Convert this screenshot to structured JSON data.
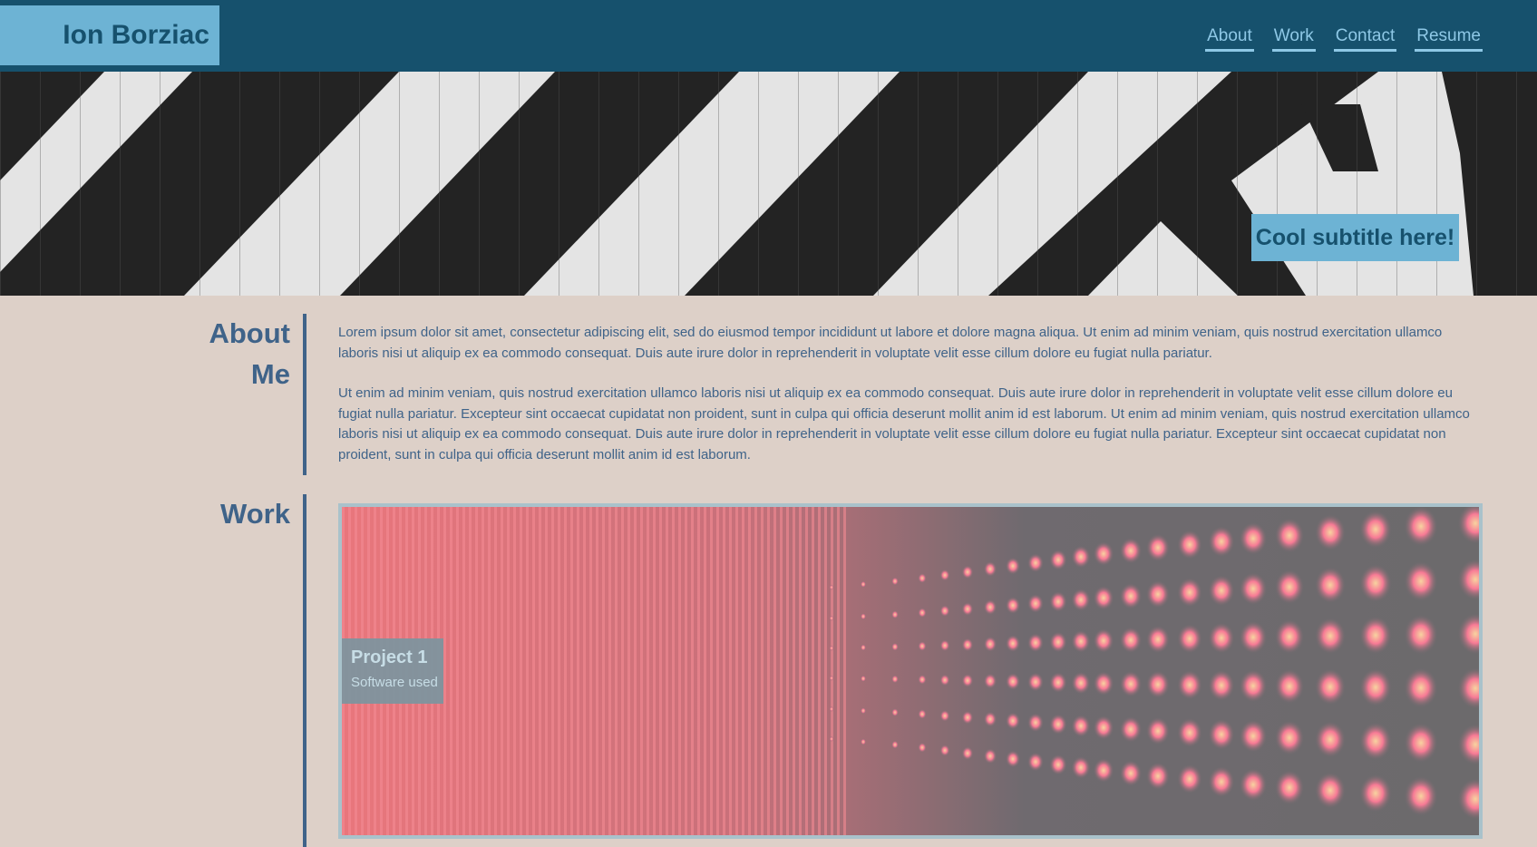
{
  "header": {
    "brand": "Ion Borziac",
    "nav": [
      {
        "label": "About"
      },
      {
        "label": "Work"
      },
      {
        "label": "Contact"
      },
      {
        "label": "Resume"
      }
    ]
  },
  "hero": {
    "subtitle": "Cool subtitle here!"
  },
  "about": {
    "title_line1": "About",
    "title_line2": "Me",
    "paragraphs": [
      "Lorem ipsum dolor sit amet, consectetur adipiscing elit, sed do eiusmod tempor incididunt ut labore et dolore magna aliqua. Ut enim ad minim veniam, quis nostrud exercitation ullamco laboris nisi ut aliquip ex ea commodo consequat. Duis aute irure dolor in reprehenderit in voluptate velit esse cillum dolore eu fugiat nulla pariatur.",
      "Ut enim ad minim veniam, quis nostrud exercitation ullamco laboris nisi ut aliquip ex ea commodo consequat. Duis aute irure dolor in reprehenderit in voluptate velit esse cillum dolore eu fugiat nulla pariatur. Excepteur sint occaecat cupidatat non proident, sunt in culpa qui officia deserunt mollit anim id est laborum. Ut enim ad minim veniam, quis nostrud exercitation ullamco laboris nisi ut aliquip ex ea commodo consequat. Duis aute irure dolor in reprehenderit in voluptate velit esse cillum dolore eu fugiat nulla pariatur. Excepteur sint occaecat cupidatat non proident, sunt in culpa qui officia deserunt mollit anim id est laborum."
    ]
  },
  "work": {
    "title": "Work",
    "projects": [
      {
        "title": "Project 1",
        "subtitle": "Software used"
      }
    ]
  },
  "colors": {
    "header_bg": "#16516d",
    "brand_bg": "#6db3d4",
    "nav_link": "#8ec8e6",
    "page_bg": "#ddd0c8",
    "accent_text": "#3f6389"
  }
}
